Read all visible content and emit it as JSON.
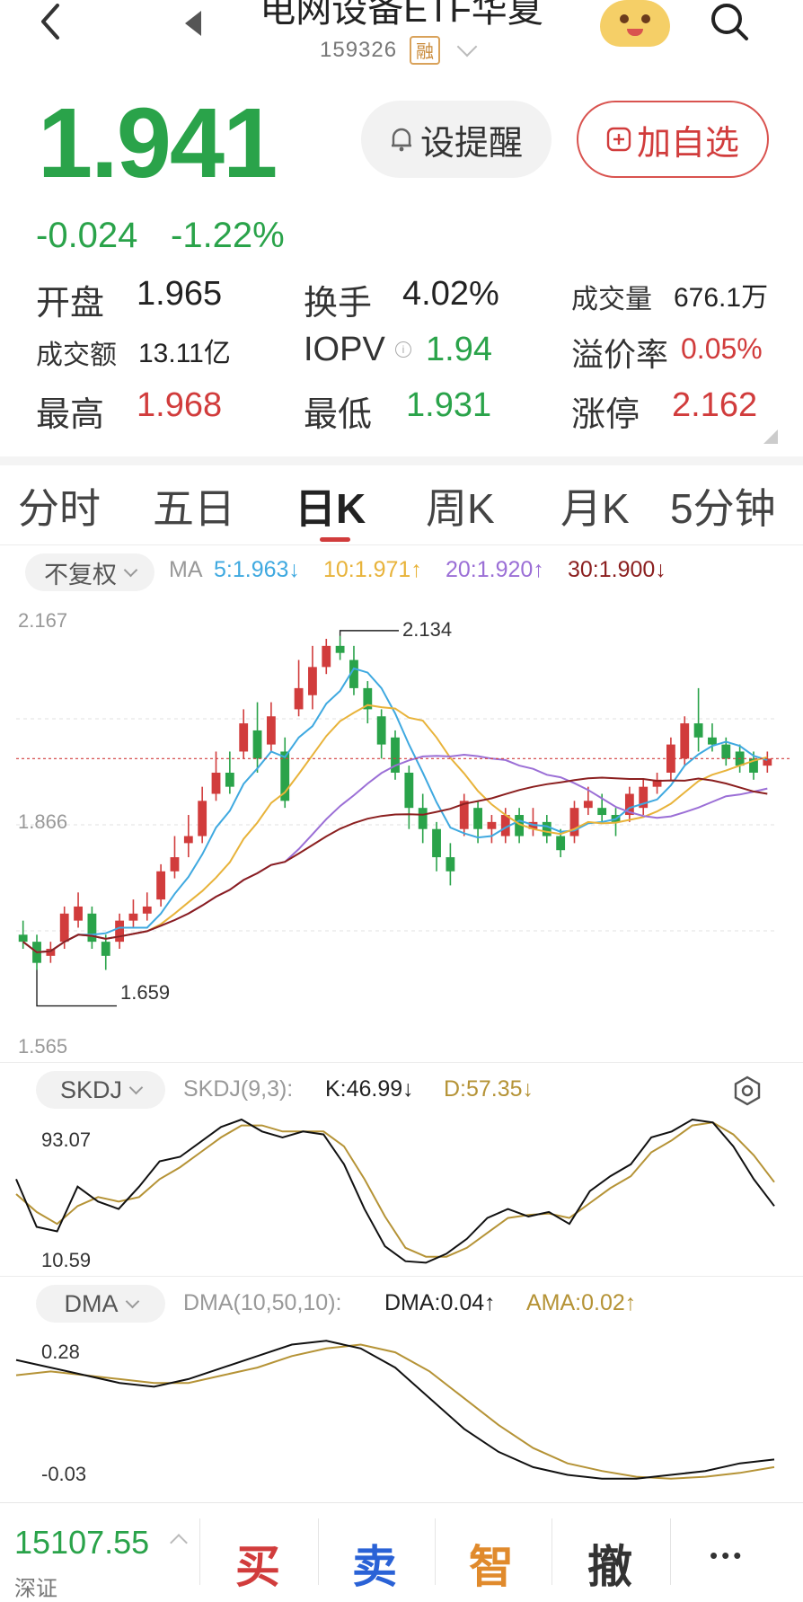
{
  "header": {
    "title": "电网设备ETF华夏",
    "code": "159326",
    "badge": "融"
  },
  "quote": {
    "price": "1.941",
    "change": "-0.024",
    "change_pct": "-1.22%",
    "alert_label": "设提醒",
    "fav_label": "加自选"
  },
  "stats": {
    "open_label": "开盘",
    "open": "1.965",
    "turnover_label": "换手",
    "turnover": "4.02%",
    "volume_label": "成交量",
    "volume": "676.1万",
    "amount_label": "成交额",
    "amount": "13.11亿",
    "iopv_label": "IOPV",
    "iopv": "1.94",
    "premium_label": "溢价率",
    "premium": "0.05%",
    "high_label": "最高",
    "high": "1.968",
    "low_label": "最低",
    "low": "1.931",
    "limit_label": "涨停",
    "limit": "2.162"
  },
  "tabs": [
    {
      "label": "分时"
    },
    {
      "label": "五日"
    },
    {
      "label": "日K"
    },
    {
      "label": "周K"
    },
    {
      "label": "月K"
    },
    {
      "label": "5分钟"
    }
  ],
  "kline": {
    "adjust_label": "不复权",
    "ma_label": "MA",
    "ma5": "5:1.963↓",
    "ma10": "10:1.971↑",
    "ma20": "20:1.920↑",
    "ma30": "30:1.900↓",
    "y_top": "2.167",
    "y_mid": "1.866",
    "y_bot": "1.565",
    "high_mark": "2.134",
    "low_mark": "1.659"
  },
  "skdj": {
    "label": "SKDJ",
    "params": "SKDJ(9,3):",
    "k": "K:46.99↓",
    "d": "D:57.35↓",
    "y_top": "93.07",
    "y_bot": "10.59"
  },
  "dma": {
    "label": "DMA",
    "params": "DMA(10,50,10):",
    "dma": "DMA:0.04↑",
    "ama": "AMA:0.02↑",
    "y_top": "0.28",
    "y_bot": "-0.03"
  },
  "bottom": {
    "index_value": "15107.55",
    "index_label": "深证",
    "buy": "买",
    "sell": "卖",
    "smart": "智",
    "cancel": "撤",
    "more": "•••"
  },
  "colors": {
    "up": "#d13c3c",
    "down": "#2aa34a",
    "ma5": "#3fa9e0",
    "ma10": "#e8b33a",
    "ma20": "#9b6fd6",
    "ma30": "#8b1f1f",
    "smart": "#e08a2c",
    "sell": "#2a62d6"
  },
  "chart_data": {
    "type": "candlestick",
    "ylim": [
      1.565,
      2.167
    ],
    "candles": [
      [
        1.71,
        1.7,
        1.73,
        1.69
      ],
      [
        1.7,
        1.67,
        1.71,
        1.66
      ],
      [
        1.68,
        1.69,
        1.7,
        1.67
      ],
      [
        1.7,
        1.74,
        1.75,
        1.69
      ],
      [
        1.73,
        1.75,
        1.77,
        1.72
      ],
      [
        1.74,
        1.7,
        1.75,
        1.69
      ],
      [
        1.7,
        1.68,
        1.71,
        1.66
      ],
      [
        1.7,
        1.73,
        1.74,
        1.69
      ],
      [
        1.73,
        1.74,
        1.76,
        1.72
      ],
      [
        1.74,
        1.75,
        1.77,
        1.73
      ],
      [
        1.76,
        1.8,
        1.81,
        1.75
      ],
      [
        1.8,
        1.82,
        1.85,
        1.79
      ],
      [
        1.84,
        1.85,
        1.88,
        1.82
      ],
      [
        1.85,
        1.9,
        1.92,
        1.84
      ],
      [
        1.91,
        1.94,
        1.97,
        1.9
      ],
      [
        1.94,
        1.92,
        1.97,
        1.91
      ],
      [
        1.97,
        2.01,
        2.03,
        1.96
      ],
      [
        2.0,
        1.96,
        2.04,
        1.94
      ],
      [
        1.98,
        2.02,
        2.04,
        1.97
      ],
      [
        1.97,
        1.9,
        1.99,
        1.89
      ],
      [
        2.03,
        2.06,
        2.1,
        2.02
      ],
      [
        2.05,
        2.09,
        2.12,
        2.03
      ],
      [
        2.09,
        2.12,
        2.13,
        2.08
      ],
      [
        2.12,
        2.11,
        2.134,
        2.1
      ],
      [
        2.1,
        2.06,
        2.12,
        2.05
      ],
      [
        2.06,
        2.03,
        2.07,
        2.01
      ],
      [
        2.02,
        1.98,
        2.03,
        1.96
      ],
      [
        1.99,
        1.94,
        2.0,
        1.93
      ],
      [
        1.94,
        1.89,
        1.95,
        1.86
      ],
      [
        1.89,
        1.86,
        1.91,
        1.84
      ],
      [
        1.86,
        1.82,
        1.87,
        1.8
      ],
      [
        1.82,
        1.8,
        1.84,
        1.78
      ],
      [
        1.86,
        1.9,
        1.91,
        1.85
      ],
      [
        1.89,
        1.86,
        1.9,
        1.84
      ],
      [
        1.86,
        1.87,
        1.88,
        1.84
      ],
      [
        1.85,
        1.88,
        1.89,
        1.84
      ],
      [
        1.88,
        1.85,
        1.89,
        1.84
      ],
      [
        1.86,
        1.87,
        1.89,
        1.85
      ],
      [
        1.87,
        1.85,
        1.88,
        1.84
      ],
      [
        1.85,
        1.83,
        1.86,
        1.82
      ],
      [
        1.85,
        1.89,
        1.9,
        1.84
      ],
      [
        1.89,
        1.9,
        1.92,
        1.88
      ],
      [
        1.89,
        1.88,
        1.91,
        1.87
      ],
      [
        1.88,
        1.87,
        1.89,
        1.85
      ],
      [
        1.88,
        1.91,
        1.92,
        1.87
      ],
      [
        1.89,
        1.92,
        1.93,
        1.88
      ],
      [
        1.92,
        1.93,
        1.94,
        1.91
      ],
      [
        1.94,
        1.98,
        1.99,
        1.93
      ],
      [
        1.96,
        2.01,
        2.02,
        1.95
      ],
      [
        2.01,
        1.99,
        2.06,
        1.97
      ],
      [
        1.99,
        1.98,
        2.01,
        1.97
      ],
      [
        1.98,
        1.96,
        1.99,
        1.95
      ],
      [
        1.97,
        1.95,
        1.98,
        1.94
      ],
      [
        1.96,
        1.94,
        1.97,
        1.93
      ],
      [
        1.95,
        1.96,
        1.97,
        1.94
      ]
    ]
  }
}
